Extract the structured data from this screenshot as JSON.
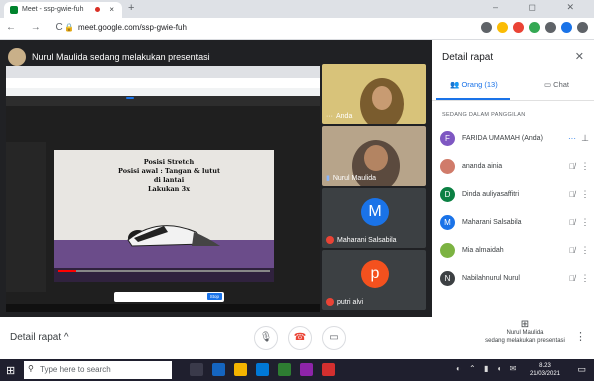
{
  "browser": {
    "tab_title": "Meet - ssp-gwie-fuh",
    "new_tab": "+",
    "tab_close": "×",
    "url": "meet.google.com/ssp-gwie-fuh",
    "nav": "←  →  C",
    "window_controls": "–  ◻  ✕"
  },
  "meet": {
    "presenter_banner": "Nurul Maulida sedang melakukan presentasi",
    "shared_video_text": [
      "Posisi Stretch",
      "Posisi awal : Tangan & lutut di lantai",
      "Lakukan 3x"
    ],
    "share_stop_label": "Stop",
    "tiles": [
      {
        "name": "Anda",
        "bg": "#d8c37a"
      },
      {
        "name": "Nurul Maulida",
        "bg": "#b7a48a"
      },
      {
        "name": "Maharani Salsabila",
        "initial": "M",
        "color": "#1a73e8"
      },
      {
        "name": "putri alvi",
        "initial": "p",
        "color": "#f4511e"
      }
    ]
  },
  "bottom_bar": {
    "details_label": "Detail rapat",
    "chevron": "^",
    "present_line1": "Nurul Maulida",
    "present_line2": "sedang melakukan presentasi"
  },
  "panel": {
    "title": "Detail rapat",
    "tab_people": "Orang (13)",
    "tab_chat": "Chat",
    "section_label": "SEDANG DALAM PANGGILAN",
    "people": [
      {
        "initial": "F",
        "name": "FARIDA UMAMAH (Anda)",
        "color": "#7e57c2"
      },
      {
        "initial": "",
        "name": "ananda ainia",
        "color": "#d07b6a"
      },
      {
        "initial": "D",
        "name": "Dinda auliyasaffitri",
        "color": "#0b8043"
      },
      {
        "initial": "M",
        "name": "Maharani Salsabila",
        "color": "#1a73e8"
      },
      {
        "initial": "",
        "name": "Mia almaidah",
        "color": "#7cb342"
      },
      {
        "initial": "N",
        "name": "Nabilahnurul Nurul",
        "color": "#3c4043"
      }
    ]
  },
  "taskbar": {
    "search_placeholder": "Type here to search",
    "time": "8.23",
    "date": "21/03/2021"
  }
}
